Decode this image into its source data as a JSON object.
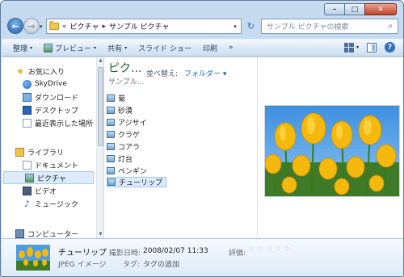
{
  "window": {
    "min_glyph": "–",
    "max_glyph": "□",
    "close_glyph": "✕"
  },
  "navigation": {
    "back_glyph": "←",
    "forward_glyph": "→",
    "recent_dropdown_glyph": "▾"
  },
  "address": {
    "overflow_chevron": "«",
    "crumbs": [
      "ピクチャ",
      "サンプル ピクチャ"
    ],
    "separator": "▸",
    "dropdown_glyph": "▾",
    "refresh_glyph": "↻"
  },
  "search": {
    "placeholder": "サンプル ピクチャの検索",
    "icon_glyph": "⌕"
  },
  "toolbar": {
    "organize": "整理",
    "preview": "プレビュー",
    "share": "共有",
    "slideshow": "スライド ショー",
    "print": "印刷",
    "more": "»",
    "dropdown_glyph": "▾",
    "help_glyph": "?"
  },
  "sidebar": {
    "favorites": "お気に入り",
    "skydrive": "SkyDrive",
    "downloads": "ダウンロード",
    "desktop": "デスクトップ",
    "recent": "最近表示した場所",
    "libraries": "ライブラリ",
    "documents": "ドキュメント",
    "pictures": "ピクチャ",
    "videos": "ビデオ",
    "music": "ミュージック",
    "computer": "コンピューター",
    "scroll_up": "▲",
    "scroll_down": "▼"
  },
  "library": {
    "title": "ピク...",
    "subtitle": "サンプル...",
    "arrange_label": "並べ替え:",
    "arrange_value": "フォルダー ▾"
  },
  "files": [
    {
      "name": "菊",
      "selected": false
    },
    {
      "name": "砂漠",
      "selected": false
    },
    {
      "name": "アジサイ",
      "selected": false
    },
    {
      "name": "クラゲ",
      "selected": false
    },
    {
      "name": "コアラ",
      "selected": false
    },
    {
      "name": "灯台",
      "selected": false
    },
    {
      "name": "ペンギン",
      "selected": false
    },
    {
      "name": "チューリップ",
      "selected": true
    }
  ],
  "details": {
    "name": "チューリップ",
    "type": "JPEG イメージ",
    "date_label": "撮影日時:",
    "date_value": "2008/02/07 11:33",
    "tag_label": "タグ:",
    "tag_value": "タグの追加",
    "rating_label": "評価:",
    "rating": 0,
    "star_glyph": "☆"
  },
  "colors": {
    "accent": "#1f64c2",
    "selection": "#dcecfc",
    "library_title": "#1e5d2f"
  }
}
